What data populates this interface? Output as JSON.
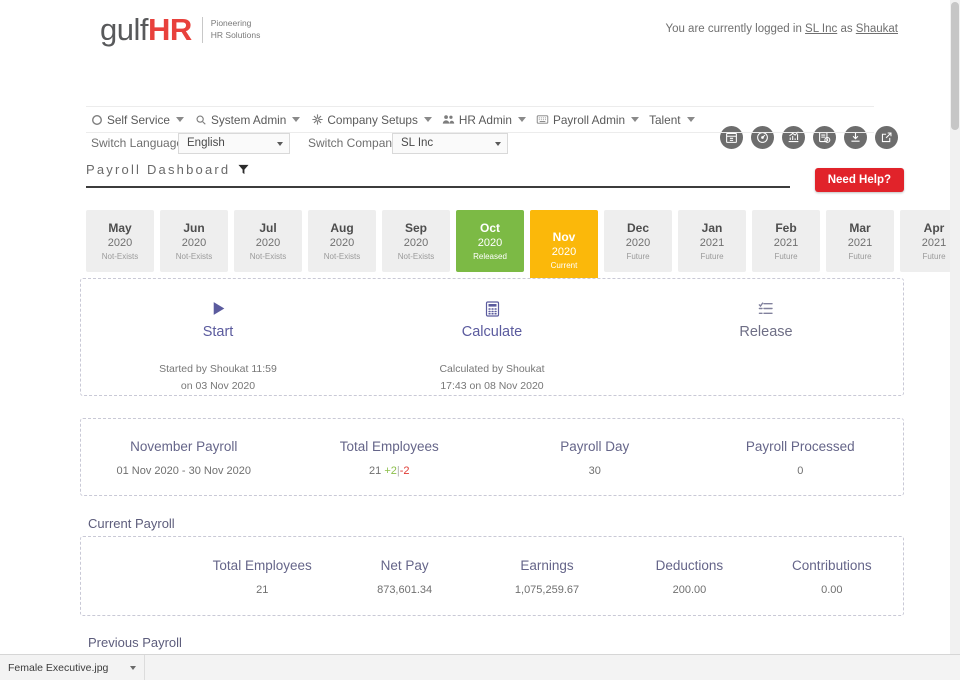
{
  "header": {
    "logo_primary": "gulf",
    "logo_accent": "HR",
    "logo_tagline_line1": "Pioneering",
    "logo_tagline_line2": "HR Solutions",
    "login_prefix": "You are currently logged in",
    "login_company": "SL Inc",
    "login_middle": "as",
    "login_user": "Shaukat"
  },
  "switch": {
    "language_label": "Switch Language",
    "language_value": "English",
    "company_label": "Switch Company",
    "company_value": "SL Inc"
  },
  "quick_icons": [
    {
      "name": "calendar-grid-icon",
      "title": "Calendar"
    },
    {
      "name": "speedometer-icon",
      "title": "Dashboard"
    },
    {
      "name": "chart-growth-icon",
      "title": "Analytics"
    },
    {
      "name": "report-clock-icon",
      "title": "Reports"
    },
    {
      "name": "download-icon",
      "title": "Download"
    },
    {
      "name": "edit-external-icon",
      "title": "Open"
    }
  ],
  "nav": [
    {
      "label": "Self Service",
      "icon": "circle-icon"
    },
    {
      "label": "System Admin",
      "icon": "gear-search-icon"
    },
    {
      "label": "Company Setups",
      "icon": "network-icon"
    },
    {
      "label": "HR Admin",
      "icon": "people-icon"
    },
    {
      "label": "Payroll Admin",
      "icon": "keyboard-icon"
    },
    {
      "label": "Talent",
      "icon": "none"
    }
  ],
  "title": {
    "text": "Payroll Dashboard",
    "filter_icon": "funnel-icon",
    "need_help": "Need Help?"
  },
  "months": [
    {
      "month": "May",
      "year": "2020",
      "status": "Not-Exists",
      "state": "none"
    },
    {
      "month": "Jun",
      "year": "2020",
      "status": "Not-Exists",
      "state": "none"
    },
    {
      "month": "Jul",
      "year": "2020",
      "status": "Not-Exists",
      "state": "none"
    },
    {
      "month": "Aug",
      "year": "2020",
      "status": "Not-Exists",
      "state": "none"
    },
    {
      "month": "Sep",
      "year": "2020",
      "status": "Not-Exists",
      "state": "none"
    },
    {
      "month": "Oct",
      "year": "2020",
      "status": "Released",
      "state": "released"
    },
    {
      "month": "Nov",
      "year": "2020",
      "status": "Current",
      "state": "current"
    },
    {
      "month": "Dec",
      "year": "2020",
      "status": "Future",
      "state": "none"
    },
    {
      "month": "Jan",
      "year": "2021",
      "status": "Future",
      "state": "none"
    },
    {
      "month": "Feb",
      "year": "2021",
      "status": "Future",
      "state": "none"
    },
    {
      "month": "Mar",
      "year": "2021",
      "status": "Future",
      "state": "none"
    },
    {
      "month": "Apr",
      "year": "2021",
      "status": "Future",
      "state": "none"
    }
  ],
  "actions": [
    {
      "label": "Start",
      "icon": "play-icon",
      "sub_line1": "Started by Shoukat 11:59",
      "sub_line2": "on 03 Nov 2020",
      "state": "done"
    },
    {
      "label": "Calculate",
      "icon": "calculator-icon",
      "sub_line1": "Calculated by Shoukat",
      "sub_line2": "17:43 on 08 Nov 2020",
      "state": "done"
    },
    {
      "label": "Release",
      "icon": "list-icon",
      "sub_line1": "",
      "sub_line2": "",
      "state": "pending"
    }
  ],
  "summary": [
    {
      "label": "November Payroll",
      "value": "01 Nov 2020 - 30 Nov 2020"
    },
    {
      "label": "Total Employees",
      "value": "21",
      "delta_plus": "+2",
      "delta_pipe": "|",
      "delta_minus": "-2"
    },
    {
      "label": "Payroll Day",
      "value": "30"
    },
    {
      "label": "Payroll Processed",
      "value": "0"
    }
  ],
  "current_payroll": {
    "heading": "Current Payroll",
    "cells": [
      {
        "label": "Total Employees",
        "value": "21"
      },
      {
        "label": "Net Pay",
        "value": "873,601.34"
      },
      {
        "label": "Earnings",
        "value": "1,075,259.67"
      },
      {
        "label": "Deductions",
        "value": "200.00"
      },
      {
        "label": "Contributions",
        "value": "0.00"
      }
    ]
  },
  "previous_payroll": {
    "heading": "Previous Payroll"
  },
  "download_shelf": {
    "filename": "Female Executive.jpg"
  },
  "colors": {
    "released_green": "#7cba45",
    "current_amber": "#fbb80a",
    "help_red": "#e1232a",
    "accent_purple": "#5b5b9e",
    "logo_red": "#e8413c"
  }
}
